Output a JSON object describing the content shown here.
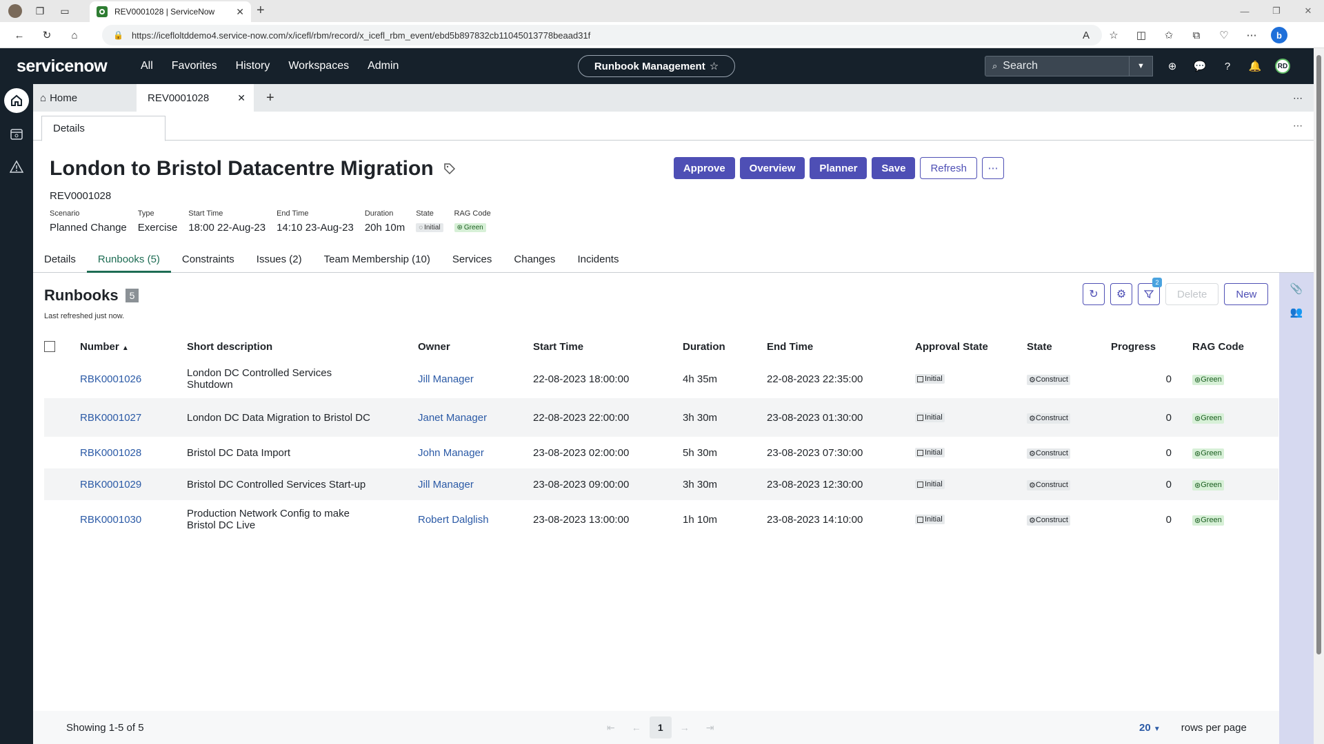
{
  "browser": {
    "tab_title": "REV0001028 | ServiceNow",
    "url": "https://icefloltddemo4.service-now.com/x/icefl/rbm/record/x_icefl_rbm_event/ebd5b897832cb11045013778beaad31f"
  },
  "header": {
    "logo": "servicenow",
    "nav": [
      "All",
      "Favorites",
      "History",
      "Workspaces",
      "Admin"
    ],
    "context": "Runbook Management",
    "search_placeholder": "Search",
    "avatar_initials": "RD"
  },
  "tabs": {
    "home": "Home",
    "record": "REV0001028"
  },
  "details_tab": "Details",
  "record": {
    "title": "London to Bristol Datacentre Migration",
    "number": "REV0001028",
    "fields": [
      {
        "label": "Scenario",
        "value": "Planned Change"
      },
      {
        "label": "Type",
        "value": "Exercise"
      },
      {
        "label": "Start Time",
        "value": "18:00 22-Aug-23"
      },
      {
        "label": "End Time",
        "value": "14:10 23-Aug-23"
      },
      {
        "label": "Duration",
        "value": "20h 10m"
      }
    ],
    "state_label": "State",
    "state_value": "Initial",
    "rag_label": "RAG Code",
    "rag_value": "Green"
  },
  "actions": {
    "approve": "Approve",
    "overview": "Overview",
    "planner": "Planner",
    "save": "Save",
    "refresh": "Refresh"
  },
  "sub_tabs": [
    "Details",
    "Runbooks (5)",
    "Constraints",
    "Issues (2)",
    "Team Membership (10)",
    "Services",
    "Changes",
    "Incidents"
  ],
  "list": {
    "title": "Runbooks",
    "count": "5",
    "refreshed": "Last refreshed just now.",
    "filter_badge": "2",
    "delete_label": "Delete",
    "new_label": "New",
    "columns": [
      "Number",
      "Short description",
      "Owner",
      "Start Time",
      "Duration",
      "End Time",
      "Approval State",
      "State",
      "Progress",
      "RAG Code"
    ],
    "rows": [
      {
        "number": "RBK0001026",
        "desc": "London DC Controlled Services Shutdown",
        "owner": "Jill Manager",
        "start": "22-08-2023 18:00:00",
        "duration": "4h 35m",
        "end": "22-08-2023 22:35:00",
        "approval": "Initial",
        "state": "Construct",
        "progress": "0",
        "rag": "Green"
      },
      {
        "number": "RBK0001027",
        "desc": "London DC Data Migration to Bristol DC",
        "owner": "Janet Manager",
        "start": "22-08-2023 22:00:00",
        "duration": "3h 30m",
        "end": "23-08-2023 01:30:00",
        "approval": "Initial",
        "state": "Construct",
        "progress": "0",
        "rag": "Green"
      },
      {
        "number": "RBK0001028",
        "desc": "Bristol DC Data Import",
        "owner": "John Manager",
        "start": "23-08-2023 02:00:00",
        "duration": "5h 30m",
        "end": "23-08-2023 07:30:00",
        "approval": "Initial",
        "state": "Construct",
        "progress": "0",
        "rag": "Green"
      },
      {
        "number": "RBK0001029",
        "desc": "Bristol DC Controlled Services Start-up",
        "owner": "Jill Manager",
        "start": "23-08-2023 09:00:00",
        "duration": "3h 30m",
        "end": "23-08-2023 12:30:00",
        "approval": "Initial",
        "state": "Construct",
        "progress": "0",
        "rag": "Green"
      },
      {
        "number": "RBK0001030",
        "desc": "Production Network Config to make Bristol DC Live",
        "owner": "Robert Dalglish",
        "start": "23-08-2023 13:00:00",
        "duration": "1h 10m",
        "end": "23-08-2023 14:10:00",
        "approval": "Initial",
        "state": "Construct",
        "progress": "0",
        "rag": "Green"
      }
    ]
  },
  "footer": {
    "showing": "Showing 1-5 of 5",
    "page": "1",
    "rows_per_page": "20",
    "rows_per_page_label": "rows per page"
  },
  "colors": {
    "header_bg": "#16212b",
    "primary": "#4e4fb5",
    "link": "#2b5aa6",
    "active_tab": "#1d6c53",
    "green_pill": "#d7f0d7"
  }
}
